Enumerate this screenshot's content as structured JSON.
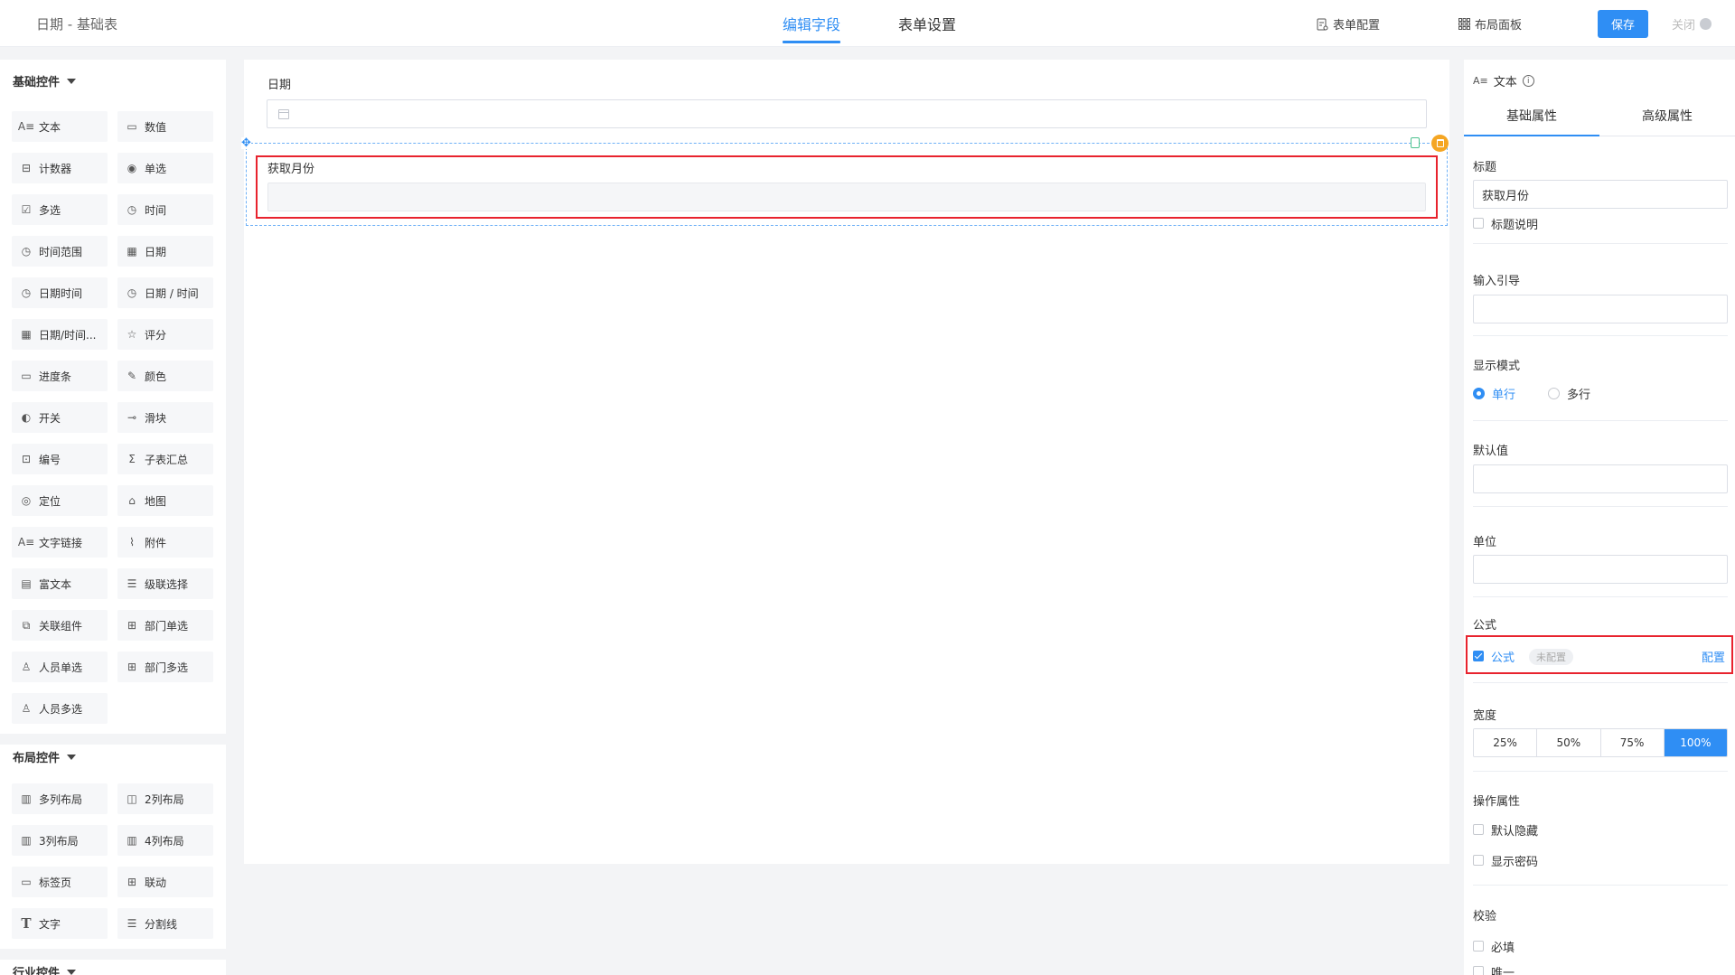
{
  "header": {
    "app_title": "日期 - 基础表",
    "tabs": [
      {
        "label": "编辑字段",
        "active": true
      },
      {
        "label": "表单设置",
        "active": false
      }
    ],
    "form_config_label": "表单配置",
    "layout_panel_label": "布局面板",
    "save_label": "保存",
    "close_label": "关闭"
  },
  "left_panel": {
    "basic_title": "基础控件",
    "basic_controls": [
      {
        "label": "文本",
        "icon": "text-icon"
      },
      {
        "label": "数值",
        "icon": "number-icon"
      },
      {
        "label": "计数器",
        "icon": "counter-icon"
      },
      {
        "label": "单选",
        "icon": "radio-icon"
      },
      {
        "label": "多选",
        "icon": "checkbox-icon"
      },
      {
        "label": "时间",
        "icon": "clock-icon"
      },
      {
        "label": "时间范围",
        "icon": "clock-icon"
      },
      {
        "label": "日期",
        "icon": "calendar-icon"
      },
      {
        "label": "日期时间",
        "icon": "clock-icon"
      },
      {
        "label": "日期 / 时间",
        "icon": "clock-icon"
      },
      {
        "label": "日期/时间...",
        "icon": "calendar-icon"
      },
      {
        "label": "评分",
        "icon": "star-icon"
      },
      {
        "label": "进度条",
        "icon": "progress-icon"
      },
      {
        "label": "颜色",
        "icon": "pipette-icon"
      },
      {
        "label": "开关",
        "icon": "toggle-icon"
      },
      {
        "label": "滑块",
        "icon": "slider-icon"
      },
      {
        "label": "编号",
        "icon": "serial-icon"
      },
      {
        "label": "子表汇总",
        "icon": "sigma-icon"
      },
      {
        "label": "定位",
        "icon": "location-icon"
      },
      {
        "label": "地图",
        "icon": "map-icon"
      },
      {
        "label": "文字链接",
        "icon": "text-link-icon"
      },
      {
        "label": "附件",
        "icon": "paperclip-icon"
      },
      {
        "label": "富文本",
        "icon": "richtext-icon"
      },
      {
        "label": "级联选择",
        "icon": "cascade-icon"
      },
      {
        "label": "关联组件",
        "icon": "relation-icon"
      },
      {
        "label": "部门单选",
        "icon": "department-icon"
      },
      {
        "label": "人员单选",
        "icon": "user-icon"
      },
      {
        "label": "部门多选",
        "icon": "departments-icon"
      },
      {
        "label": "人员多选",
        "icon": "users-icon"
      }
    ],
    "layout_title": "布局控件",
    "layout_controls": [
      {
        "label": "多列布局",
        "icon": "columns-icon"
      },
      {
        "label": "2列布局",
        "icon": "columns-icon"
      },
      {
        "label": "3列布局",
        "icon": "columns-icon"
      },
      {
        "label": "4列布局",
        "icon": "columns-icon"
      },
      {
        "label": "标签页",
        "icon": "tabs-icon"
      },
      {
        "label": "联动",
        "icon": "grid-icon"
      },
      {
        "label": "文字",
        "icon": "type-icon"
      },
      {
        "label": "分割线",
        "icon": "divider-icon"
      }
    ],
    "industry_title": "行业控件"
  },
  "canvas": {
    "date_field_label": "日期",
    "month_field_label": "获取月份"
  },
  "right_panel": {
    "header_label": "文本",
    "tabs": [
      {
        "label": "基础属性",
        "active": true
      },
      {
        "label": "高级属性",
        "active": false
      }
    ],
    "title_label": "标题",
    "title_value": "获取月份",
    "title_desc_label": "标题说明",
    "input_guide_label": "输入引导",
    "display_mode_label": "显示模式",
    "display_single": "单行",
    "display_multi": "多行",
    "default_value_label": "默认值",
    "unit_label": "单位",
    "formula_section_label": "公式",
    "formula_checkbox_label": "公式",
    "formula_status": "未配置",
    "formula_config_link": "配置",
    "width_label": "宽度",
    "width_options": [
      "25%",
      "50%",
      "75%",
      "100%"
    ],
    "width_selected": "100%",
    "operation_label": "操作属性",
    "default_hidden_label": "默认隐藏",
    "show_password_label": "显示密码",
    "validation_label": "校验",
    "required_label": "必填",
    "unique_label": "唯一"
  },
  "colors": {
    "accent": "#2f8ef4",
    "highlight": "#e8232e",
    "delete_badge": "#f5a623"
  }
}
